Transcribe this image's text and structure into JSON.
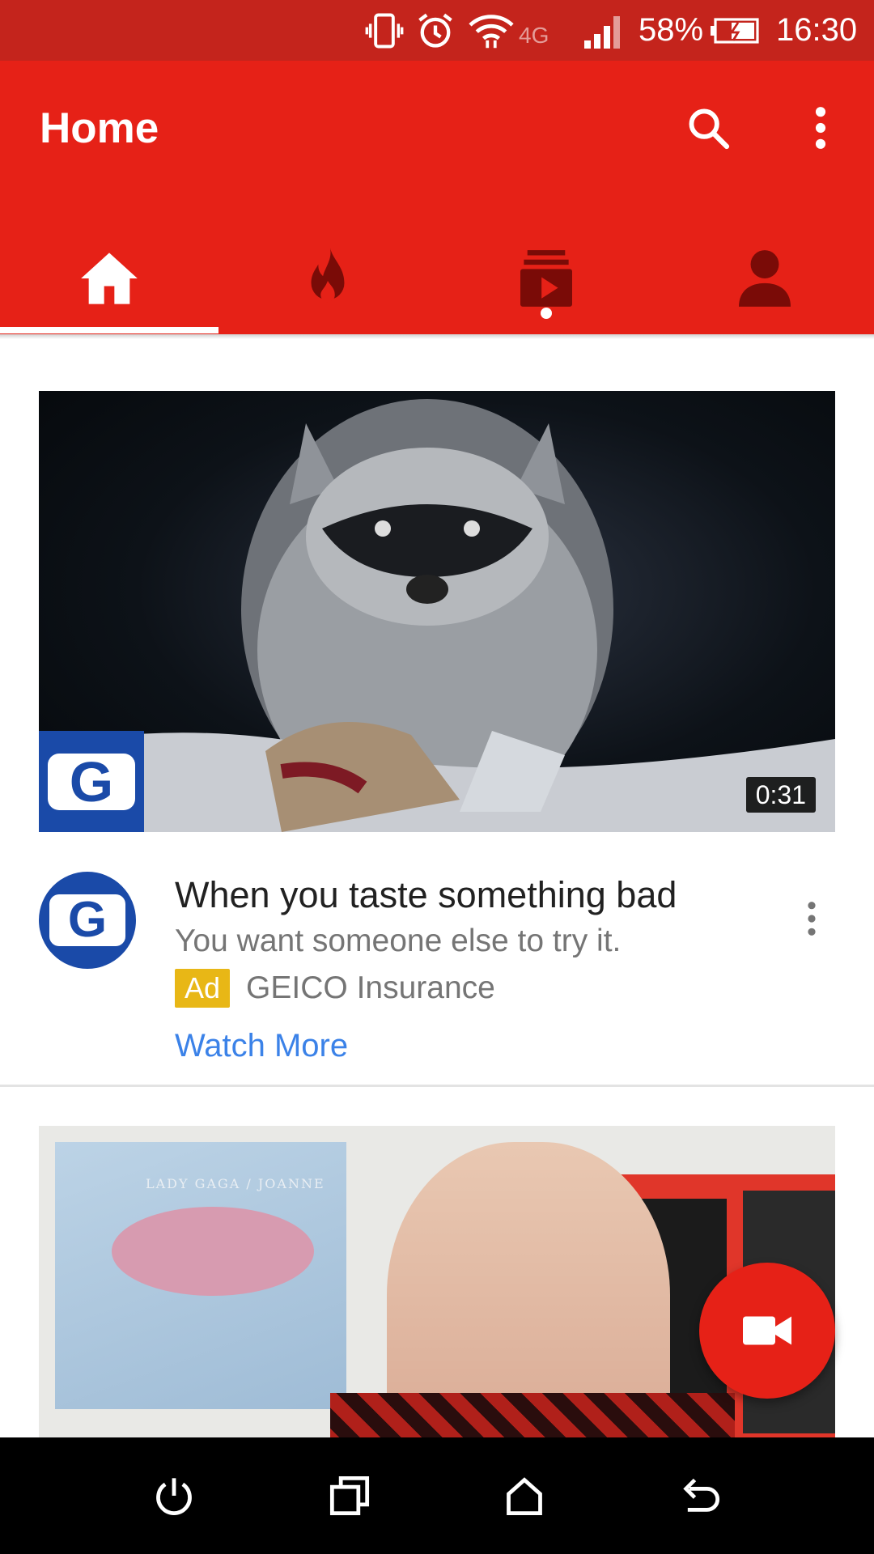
{
  "status_bar": {
    "network": "4G",
    "battery": "58%",
    "time": "16:30",
    "icons": [
      "vibrate-icon",
      "alarm-icon",
      "wifi-icon",
      "signal-icon",
      "battery-charging-icon"
    ]
  },
  "app_bar": {
    "title": "Home",
    "actions": [
      "search-icon",
      "more-vert-icon"
    ],
    "tabs": [
      {
        "icon": "home-icon",
        "selected": true
      },
      {
        "icon": "trending-icon",
        "selected": false
      },
      {
        "icon": "subscriptions-icon",
        "selected": false,
        "has_new": true
      },
      {
        "icon": "account-icon",
        "selected": false
      }
    ]
  },
  "feed": {
    "ad_card": {
      "duration": "0:31",
      "logo_letter": "G",
      "title": "When you taste something bad",
      "subtitle": "You want someone else to try it.",
      "badge": "Ad",
      "advertiser": "GEICO Insurance",
      "cta": "Watch More"
    },
    "second_card": {
      "album_text": "LADY GAGA / JOANNE"
    }
  },
  "fab": {
    "icon": "video-camera-icon"
  },
  "nav_bar": {
    "buttons": [
      "power-icon",
      "recent-apps-icon",
      "home-nav-icon",
      "back-icon"
    ]
  },
  "colors": {
    "primary": "#e62117",
    "status": "#c4241c",
    "ad_badge": "#e8b716",
    "link": "#3b82e8"
  }
}
